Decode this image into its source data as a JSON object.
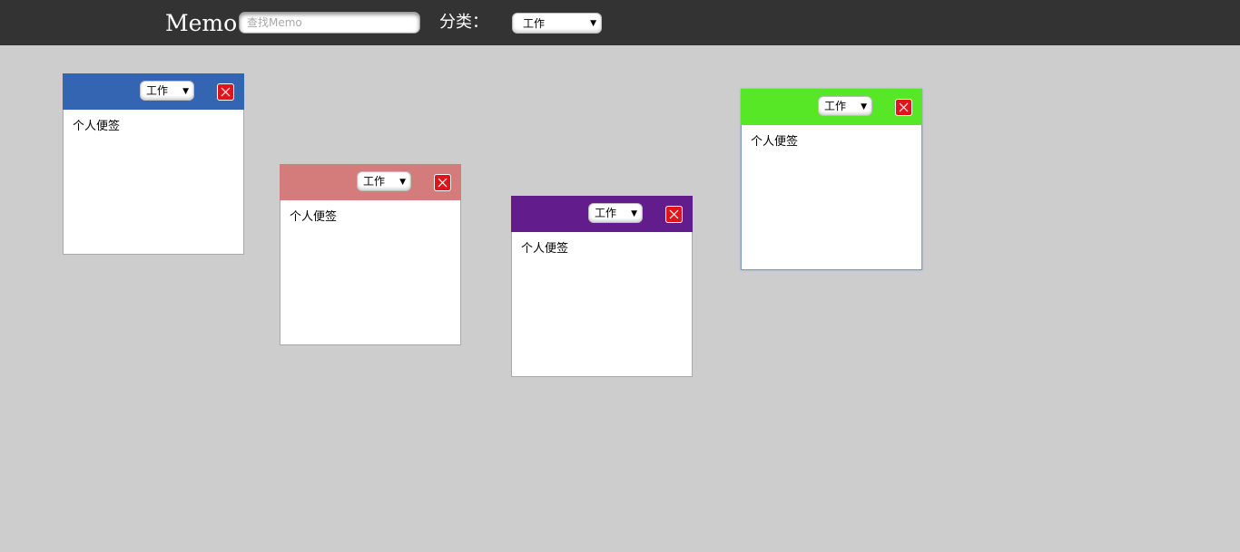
{
  "header": {
    "logo": "Memo",
    "search_placeholder": "查找Memo",
    "category_label": "分类：",
    "category_selected": "工作"
  },
  "notes": [
    {
      "color": "#3465b3",
      "category": "工作",
      "text": "个人便签"
    },
    {
      "color": "#d47b7c",
      "category": "工作",
      "text": "个人便签"
    },
    {
      "color": "#621c8b",
      "category": "工作",
      "text": "个人便签"
    },
    {
      "color": "#57e726",
      "category": "工作",
      "text": "个人便签"
    }
  ],
  "icons": {
    "dropdown": "chevron-down-icon",
    "close": "close-icon"
  }
}
